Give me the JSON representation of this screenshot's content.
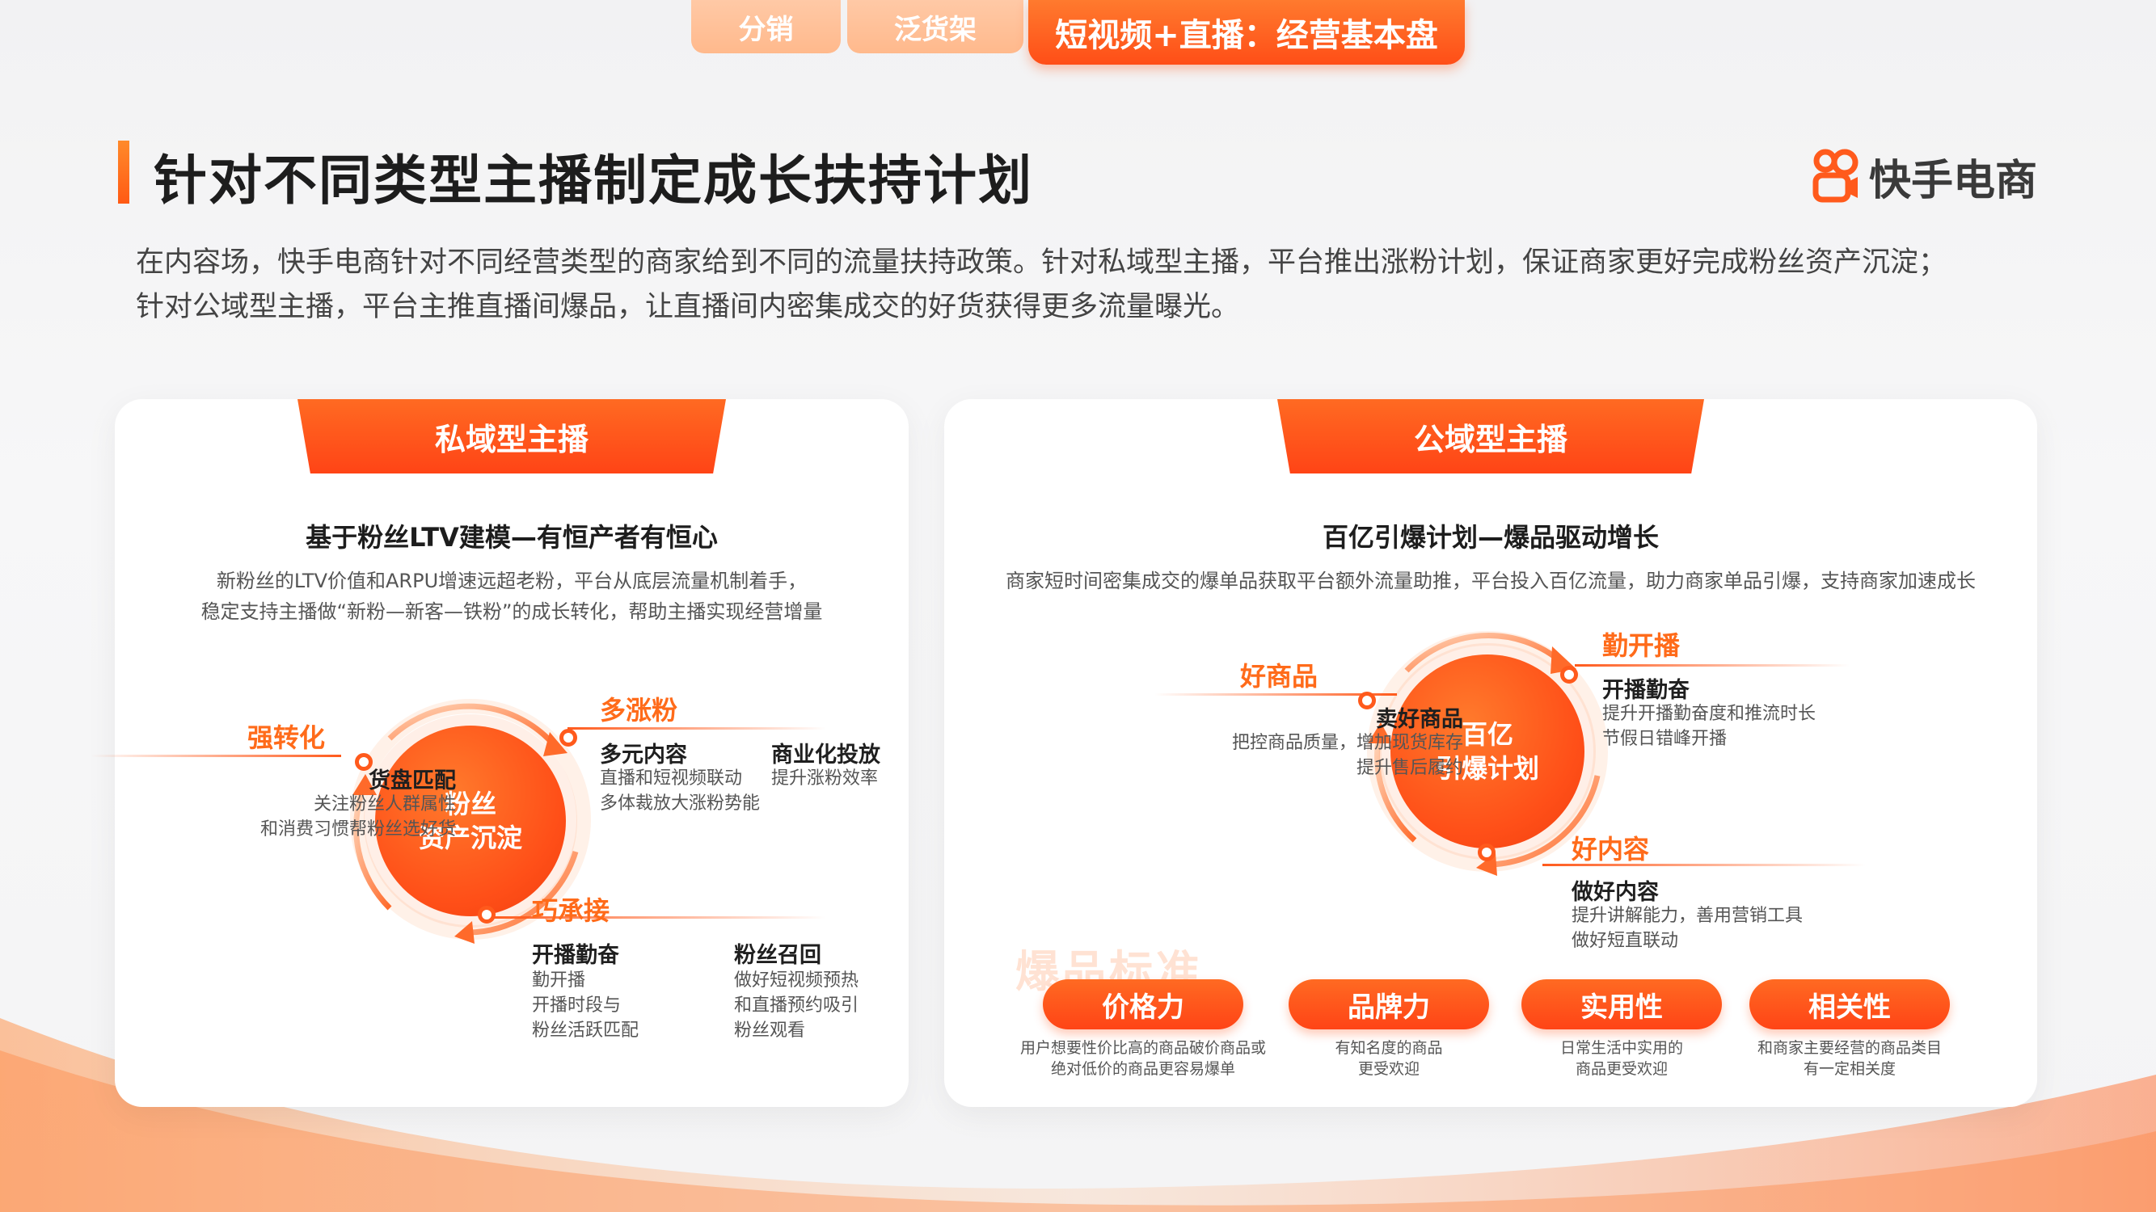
{
  "tabs": [
    {
      "label": "分销"
    },
    {
      "label": "泛货架"
    },
    {
      "label": "短视频+直播：经营基本盘"
    }
  ],
  "header": {
    "title": "针对不同类型主播制定成长扶持计划",
    "brand": "快手电商",
    "intro_line1": "在内容场，快手电商针对不同经营类型的商家给到不同的流量扶持政策。针对私域型主播，平台推出涨粉计划，保证商家更好完成粉丝资产沉淀；",
    "intro_line2": "针对公域型主播，平台主推直播间爆品，让直播间内密集成交的好货获得更多流量曝光。"
  },
  "private": {
    "tag": "私域型主播",
    "heading": "基于粉丝LTV建模—有恒产者有恒心",
    "desc_line1": "新粉丝的LTV价值和ARPU增速远超老粉，平台从底层流量机制着手，",
    "desc_line2": "稳定支持主播做“新粉—新客—铁粉”的成长转化，帮助主播实现经营增量",
    "center_line1": "粉丝",
    "center_line2": "资产沉淀",
    "node_top": {
      "label": "多涨粉",
      "item1_title": "多元内容",
      "item1_line1": "直播和短视频联动",
      "item1_line2": "多体裁放大涨粉势能",
      "item2_title": "商业化投放",
      "item2_line1": "提升涨粉效率"
    },
    "node_left": {
      "label": "强转化",
      "title": "货盘匹配",
      "line1": "关注粉丝人群属性",
      "line2": "和消费习惯帮粉丝选好货"
    },
    "node_bottom": {
      "label": "巧承接",
      "item1_title": "开播勤奋",
      "item1_line1": "勤开播",
      "item1_line2": "开播时段与",
      "item1_line3": "粉丝活跃匹配",
      "item2_title": "粉丝召回",
      "item2_line1": "做好短视频预热",
      "item2_line2": "和直播预约吸引",
      "item2_line3": "粉丝观看"
    }
  },
  "public": {
    "tag": "公域型主播",
    "heading": "百亿引爆计划—爆品驱动增长",
    "desc_line1": "商家短时间密集成交的爆单品获取平台额外流量助推，平台投入百亿流量，助力商家单品引爆，支持商家加速成长",
    "center_line1": "百亿",
    "center_line2": "引爆计划",
    "node_left": {
      "label": "好商品",
      "title": "卖好商品",
      "line1": "把控商品质量，增加现货库存",
      "line2": "提升售后履约"
    },
    "node_top_right": {
      "label": "勤开播",
      "title": "开播勤奋",
      "line1": "提升开播勤奋度和推流时长",
      "line2": "节假日错峰开播"
    },
    "node_bottom_right": {
      "label": "好内容",
      "title": "做好内容",
      "line1": "提升讲解能力，善用营销工具",
      "line2": "做好短直联动"
    },
    "watermark": "爆品标准",
    "standards": [
      {
        "label": "价格力",
        "line1": "用户想要性价比高的商品破价商品或",
        "line2": "绝对低价的商品更容易爆单"
      },
      {
        "label": "品牌力",
        "line1": "有知名度的商品",
        "line2": "更受欢迎"
      },
      {
        "label": "实用性",
        "line1": "日常生活中实用的",
        "line2": "商品更受欢迎"
      },
      {
        "label": "相关性",
        "line1": "和商家主要经营的商品类目",
        "line2": "有一定相关度"
      }
    ]
  },
  "colors": {
    "accent": "#ff5a1c",
    "accent_light": "#ffb98c",
    "text_dark": "#1d1d1d"
  }
}
